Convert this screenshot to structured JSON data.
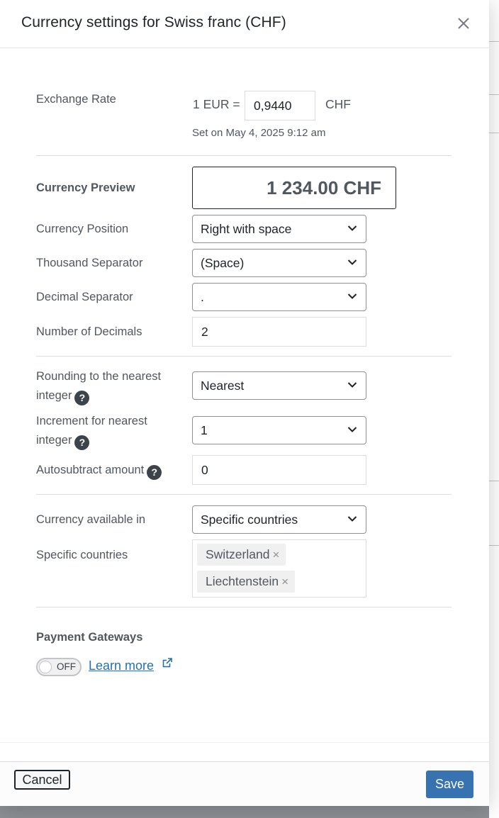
{
  "modal": {
    "title": "Currency settings for Swiss franc (CHF)"
  },
  "exchange_rate": {
    "label": "Exchange Rate",
    "prefix": "1 EUR =",
    "value": "0,9440",
    "suffix": "CHF",
    "note": "Set on May 4, 2025 9:12 am"
  },
  "preview": {
    "label": "Currency Preview",
    "value": "1 234.00 CHF"
  },
  "currency_position": {
    "label": "Currency Position",
    "selected": "Right with space"
  },
  "thousand_separator": {
    "label": "Thousand Separator",
    "selected": "(Space)"
  },
  "decimal_separator": {
    "label": "Decimal Separator",
    "selected": "."
  },
  "number_of_decimals": {
    "label": "Number of Decimals",
    "value": "2"
  },
  "rounding": {
    "label_line1": "Rounding to the nearest",
    "label_line2": "integer",
    "selected": "Nearest"
  },
  "increment": {
    "label_line1": "Increment for nearest",
    "label_line2": "integer",
    "selected": "1"
  },
  "autosubtract": {
    "label": "Autosubtract amount",
    "value": "0"
  },
  "availability": {
    "label": "Currency available in",
    "selected": "Specific countries"
  },
  "specific_countries": {
    "label": "Specific countries",
    "chips": [
      "Switzerland",
      "Liechtenstein"
    ],
    "remove_glyph": "×"
  },
  "payment_gateways": {
    "heading": "Payment Gateways",
    "toggle_label": "OFF",
    "toggle_state": false,
    "learn_more": "Learn more"
  },
  "help_glyph": "?",
  "footer": {
    "cancel_label": "Cancel",
    "save_label": "Save"
  },
  "colors": {
    "primary": "#3773b0",
    "link": "#2271b1",
    "text": "#50575e",
    "heading": "#1d2327",
    "overlay": "#8c8f94"
  }
}
